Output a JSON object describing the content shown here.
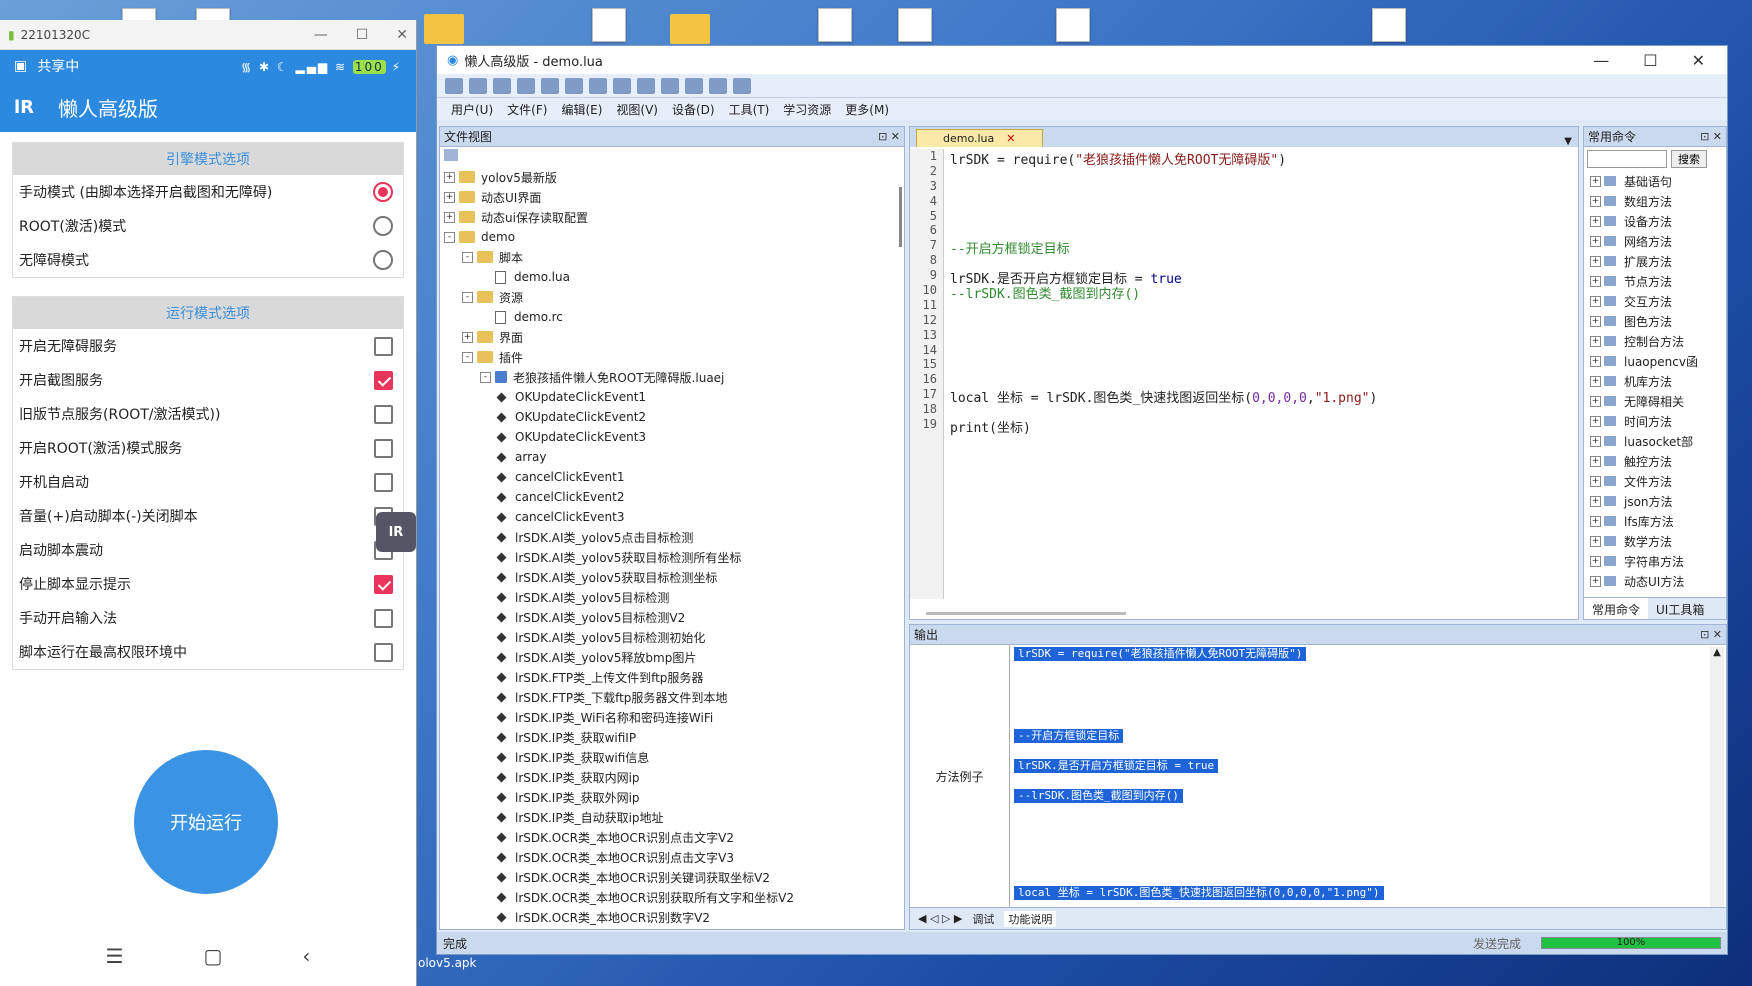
{
  "desktop": {
    "bottom_label": "olov5.apk"
  },
  "phone": {
    "window_title": "22101320C",
    "status_left": "共享中",
    "status_right": "100",
    "app_title": "懒人高级版",
    "engine_section": "引擎模式选项",
    "engine_options": [
      {
        "label": "手动模式 (由脚本选择开启截图和无障碍)",
        "selected": true
      },
      {
        "label": "ROOT(激活)模式",
        "selected": false
      },
      {
        "label": "无障碍模式",
        "selected": false
      }
    ],
    "run_section": "运行模式选项",
    "run_options": [
      {
        "label": "开启无障碍服务",
        "checked": false
      },
      {
        "label": "开启截图服务",
        "checked": true
      },
      {
        "label": "旧版节点服务(ROOT/激活模式))",
        "checked": false
      },
      {
        "label": "开启ROOT(激活)模式服务",
        "checked": false
      },
      {
        "label": "开机自启动",
        "checked": false
      },
      {
        "label": "音量(+)启动脚本(-)关闭脚本",
        "checked": false
      },
      {
        "label": "启动脚本震动",
        "checked": false
      },
      {
        "label": "停止脚本显示提示",
        "checked": true
      },
      {
        "label": "手动开启输入法",
        "checked": false
      },
      {
        "label": "脚本运行在最高权限环境中",
        "checked": false
      }
    ],
    "start_button": "开始运行",
    "nav": {
      "menu": "☰",
      "home": "▢",
      "back": "‹"
    }
  },
  "ide": {
    "title": "懒人高级版 - demo.lua",
    "menu": [
      "用户(U)",
      "文件(F)",
      "编辑(E)",
      "视图(V)",
      "设备(D)",
      "工具(T)",
      "学习资源",
      "更多(M)"
    ],
    "file_view_title": "文件视图",
    "tree": [
      {
        "level": 0,
        "type": "folder",
        "exp": "+",
        "label": "yolov5最新版"
      },
      {
        "level": 0,
        "type": "folder",
        "exp": "+",
        "label": "动态UI界面"
      },
      {
        "level": 0,
        "type": "folder",
        "exp": "+",
        "label": "动态ui保存读取配置"
      },
      {
        "level": 0,
        "type": "folder",
        "exp": "-",
        "label": "demo"
      },
      {
        "level": 1,
        "type": "folder",
        "exp": "-",
        "label": "脚本"
      },
      {
        "level": 2,
        "type": "file",
        "label": "demo.lua"
      },
      {
        "level": 1,
        "type": "folder",
        "exp": "-",
        "label": "资源"
      },
      {
        "level": 2,
        "type": "file",
        "label": "demo.rc"
      },
      {
        "level": 1,
        "type": "folder",
        "exp": "+",
        "label": "界面"
      },
      {
        "level": 1,
        "type": "folder",
        "exp": "-",
        "label": "插件"
      },
      {
        "level": 2,
        "type": "plugin",
        "exp": "-",
        "label": "老狼孩插件懒人免ROOT无障碍版.luaej"
      },
      {
        "level": 3,
        "type": "method",
        "label": "OKUpdateClickEvent1"
      },
      {
        "level": 3,
        "type": "method",
        "label": "OKUpdateClickEvent2"
      },
      {
        "level": 3,
        "type": "method",
        "label": "OKUpdateClickEvent3"
      },
      {
        "level": 3,
        "type": "method",
        "label": "array"
      },
      {
        "level": 3,
        "type": "method",
        "label": "cancelClickEvent1"
      },
      {
        "level": 3,
        "type": "method",
        "label": "cancelClickEvent2"
      },
      {
        "level": 3,
        "type": "method",
        "label": "cancelClickEvent3"
      },
      {
        "level": 3,
        "type": "method",
        "label": "lrSDK.AI类_yolov5点击目标检测"
      },
      {
        "level": 3,
        "type": "method",
        "label": "lrSDK.AI类_yolov5获取目标检测所有坐标"
      },
      {
        "level": 3,
        "type": "method",
        "label": "lrSDK.AI类_yolov5获取目标检测坐标"
      },
      {
        "level": 3,
        "type": "method",
        "label": "lrSDK.AI类_yolov5目标检测"
      },
      {
        "level": 3,
        "type": "method",
        "label": "lrSDK.AI类_yolov5目标检测V2"
      },
      {
        "level": 3,
        "type": "method",
        "label": "lrSDK.AI类_yolov5目标检测初始化"
      },
      {
        "level": 3,
        "type": "method",
        "label": "lrSDK.AI类_yolov5释放bmp图片"
      },
      {
        "level": 3,
        "type": "method",
        "label": "lrSDK.FTP类_上传文件到ftp服务器"
      },
      {
        "level": 3,
        "type": "method",
        "label": "lrSDK.FTP类_下载ftp服务器文件到本地"
      },
      {
        "level": 3,
        "type": "method",
        "label": "lrSDK.IP类_WiFi名称和密码连接WiFi"
      },
      {
        "level": 3,
        "type": "method",
        "label": "lrSDK.IP类_获取wifiIP"
      },
      {
        "level": 3,
        "type": "method",
        "label": "lrSDK.IP类_获取wifi信息"
      },
      {
        "level": 3,
        "type": "method",
        "label": "lrSDK.IP类_获取内网ip"
      },
      {
        "level": 3,
        "type": "method",
        "label": "lrSDK.IP类_获取外网ip"
      },
      {
        "level": 3,
        "type": "method",
        "label": "lrSDK.IP类_自动获取ip地址"
      },
      {
        "level": 3,
        "type": "method",
        "label": "lrSDK.OCR类_本地OCR识别点击文字V2"
      },
      {
        "level": 3,
        "type": "method",
        "label": "lrSDK.OCR类_本地OCR识别点击文字V3"
      },
      {
        "level": 3,
        "type": "method",
        "label": "lrSDK.OCR类_本地OCR识别关键词获取坐标V2"
      },
      {
        "level": 3,
        "type": "method",
        "label": "lrSDK.OCR类_本地OCR识别获取所有文字和坐标V2"
      },
      {
        "level": 3,
        "type": "method",
        "label": "lrSDK.OCR类_本地OCR识别数字V2"
      }
    ],
    "editor_tab": "demo.lua",
    "line_numbers": [
      "1",
      "2",
      "3",
      "4",
      "5",
      "6",
      "7",
      "8",
      "9",
      "10",
      "11",
      "12",
      "13",
      "14",
      "15",
      "16",
      "17",
      "18",
      "19"
    ],
    "code": {
      "l1_a": "lrSDK = require(",
      "l1_b": "\"老狼孩插件懒人免ROOT无障碍版\"",
      "l1_c": ")",
      "l7": "--开启方框锁定目标",
      "l9_a": "lrSDK.是否开启方框锁定目标 = ",
      "l9_b": "true",
      "l10": "--lrSDK.图色类_截图到内存()",
      "l17_a": "local 坐标 = lrSDK.图色类_快速找图返回坐标(",
      "l17_b": "0,0,0,0",
      "l17_c": ",",
      "l17_d": "\"1.png\"",
      "l17_e": ")",
      "l19": "print(坐标)"
    },
    "cmd_title": "常用命令",
    "cmd_search_btn": "搜索",
    "cmd_items": [
      "基础语句",
      "数组方法",
      "设备方法",
      "网络方法",
      "扩展方法",
      "节点方法",
      "交互方法",
      "图色方法",
      "控制台方法",
      "luaopencv函",
      "机库方法",
      "无障碍相关",
      "时间方法",
      "luasocket部",
      "触控方法",
      "文件方法",
      "json方法",
      "lfs库方法",
      "数学方法",
      "字符串方法",
      "动态UI方法"
    ],
    "cmd_tabs": [
      "常用命令",
      "UI工具箱"
    ],
    "output_title": "输出",
    "output_side": "方法例子",
    "output_lines": [
      "lrSDK = require(\"老狼孩插件懒人免ROOT无障碍版\")",
      "--开启方框锁定目标",
      "lrSDK.是否开启方框锁定目标 = true",
      "--lrSDK.图色类_截图到内存()",
      "local 坐标 = lrSDK.图色类_快速找图返回坐标(0,0,0,0,\"1.png\")"
    ],
    "output_tabs": [
      "调试",
      "功能说明"
    ],
    "status_left": "完成",
    "status_right": "发送完成",
    "progress": 1.0,
    "progress_label": "100%"
  }
}
